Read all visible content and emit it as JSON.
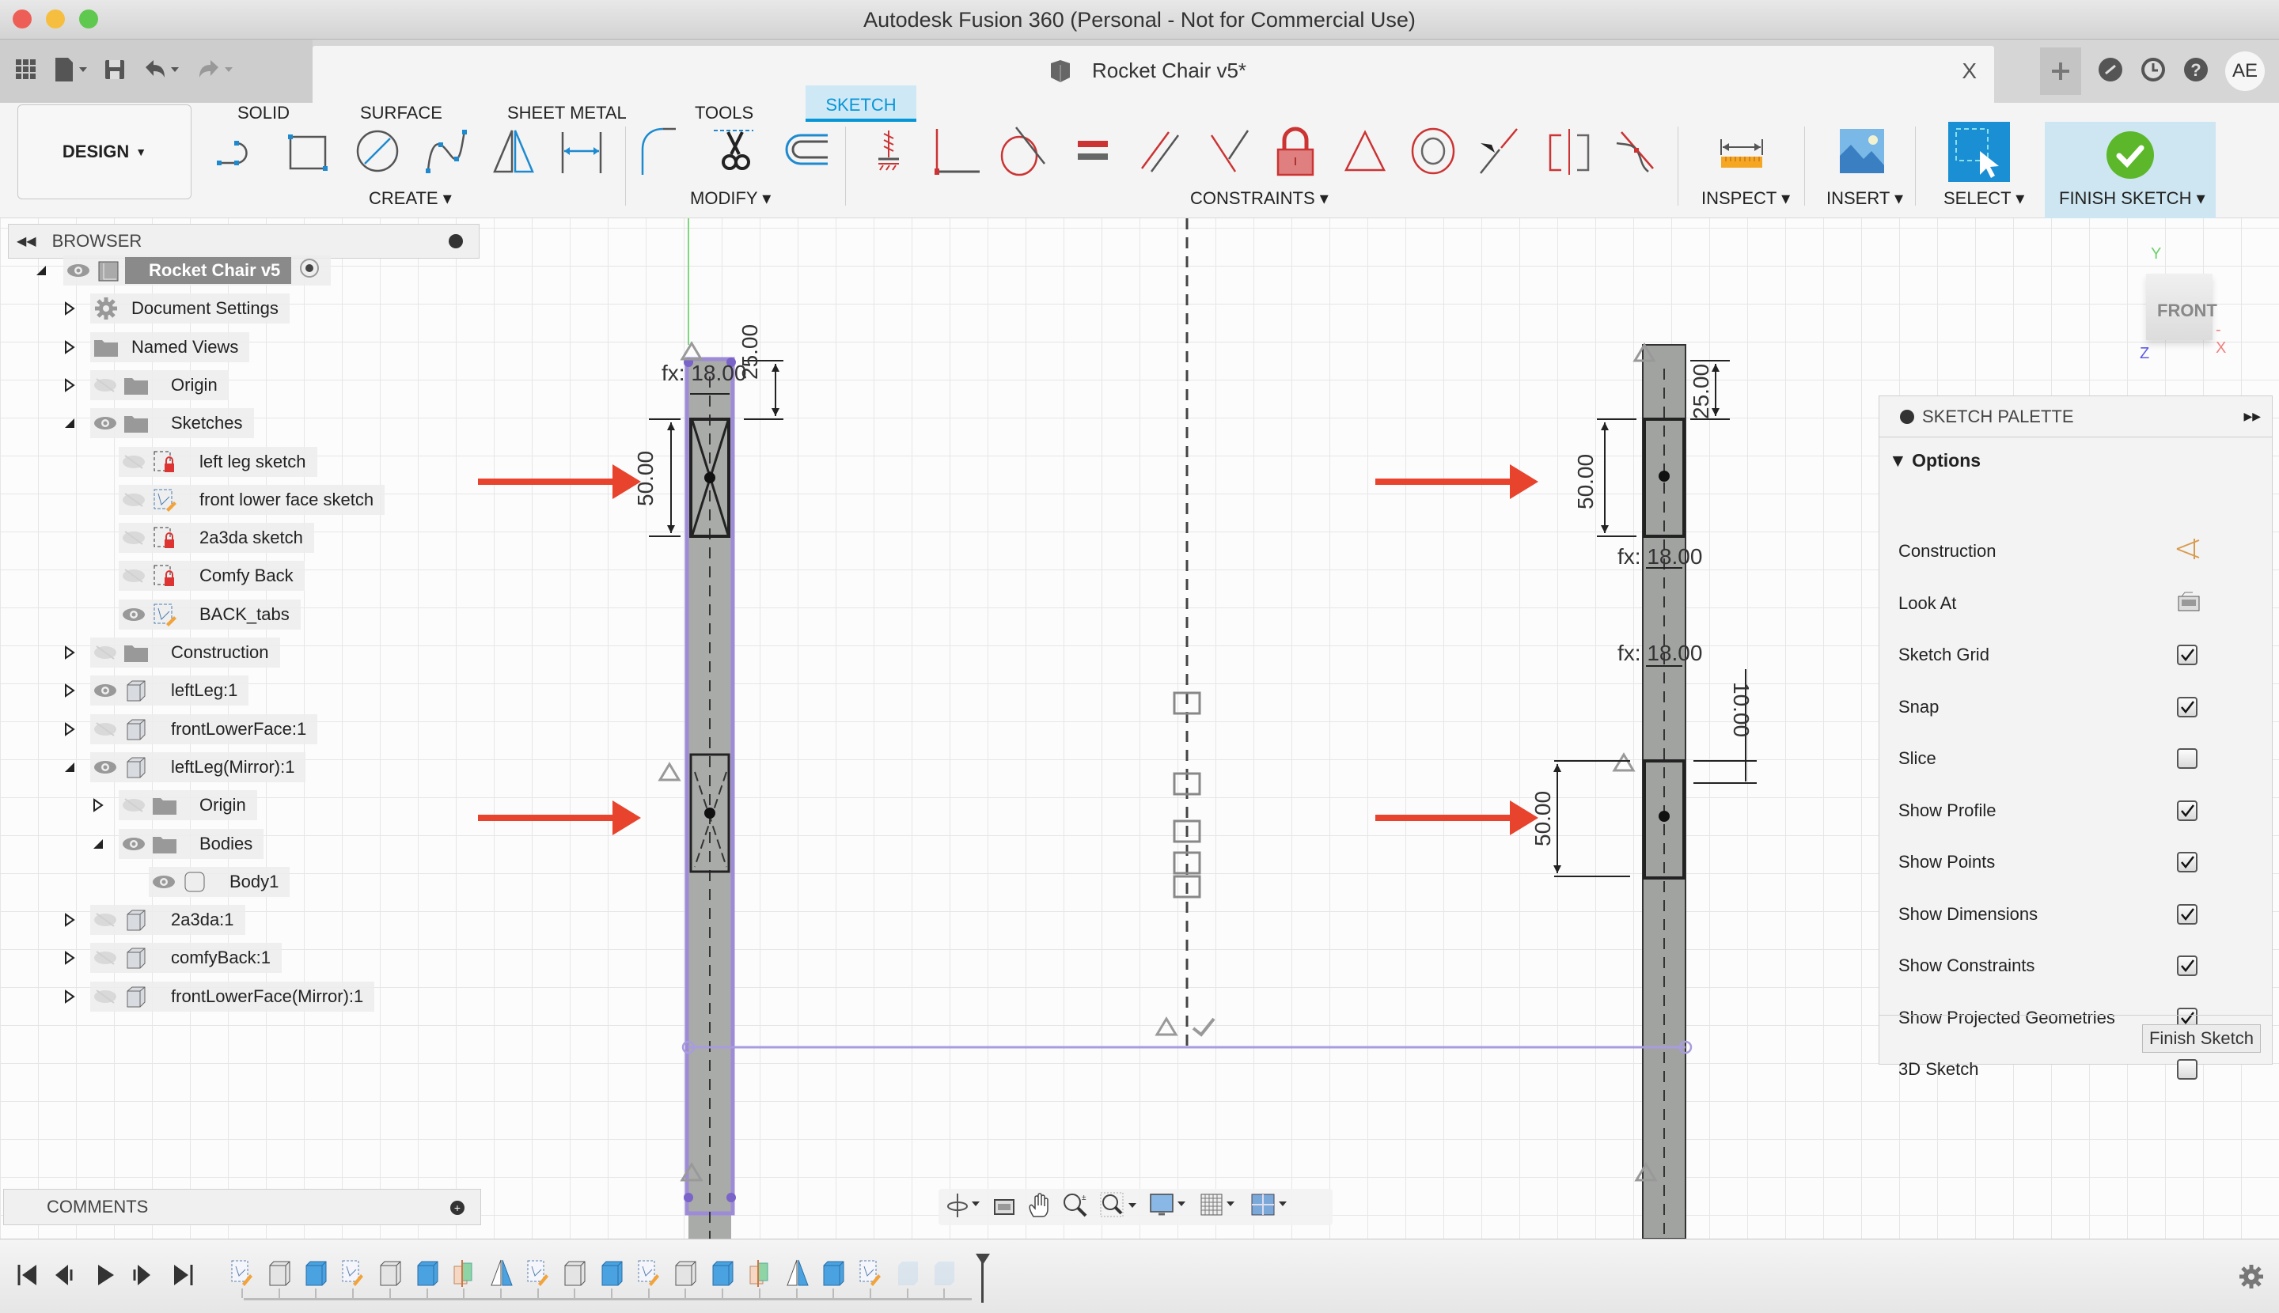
{
  "window": {
    "title": "Autodesk Fusion 360 (Personal - Not for Commercial Use)",
    "traffic_lights": {
      "close": "#ed5f56",
      "minimize": "#f6be3f",
      "zoom": "#5fc84e"
    }
  },
  "tabbar": {
    "quick_access": [
      "data-panel-icon",
      "file-menu-icon",
      "save-icon",
      "undo-icon",
      "redo-icon"
    ],
    "document_tab": "Rocket Chair v5*",
    "close_tab_glyph": "X",
    "right_icons": [
      "new-tab-icon",
      "job-status-icon",
      "history-icon",
      "help-icon"
    ],
    "user_initials": "AE"
  },
  "ribbon": {
    "workspace": "DESIGN",
    "tabs": [
      {
        "label": "SOLID",
        "active": false
      },
      {
        "label": "SURFACE",
        "active": false
      },
      {
        "label": "SHEET METAL",
        "active": false
      },
      {
        "label": "TOOLS",
        "active": false
      },
      {
        "label": "SKETCH",
        "active": true
      }
    ],
    "groups": {
      "create": {
        "label": "CREATE",
        "tools": [
          "line",
          "rectangle",
          "circle",
          "spline",
          "mirror",
          "sketch-dimension"
        ]
      },
      "modify": {
        "label": "MODIFY",
        "tools": [
          "fillet",
          "trim",
          "offset"
        ]
      },
      "constraints": {
        "label": "CONSTRAINTS",
        "tools": [
          "fix",
          "coincident",
          "tangent",
          "equal",
          "parallel",
          "perpendicular",
          "fix-unfix",
          "midpoint",
          "concentric",
          "collinear",
          "symmetry",
          "curvature"
        ]
      },
      "inspect": {
        "label": "INSPECT"
      },
      "insert": {
        "label": "INSERT"
      },
      "select": {
        "label": "SELECT"
      },
      "finish": {
        "label": "FINISH SKETCH"
      }
    },
    "accent": "#0696d7"
  },
  "browser": {
    "title": "BROWSER",
    "items": [
      {
        "label": "Rocket Chair v5",
        "depth": 0,
        "expanded": true,
        "visible": true,
        "icon": "component-icon",
        "root": true
      },
      {
        "label": "Document Settings",
        "depth": 1,
        "expanded": false,
        "icon": "gear-icon"
      },
      {
        "label": "Named Views",
        "depth": 1,
        "expanded": false,
        "icon": "folder-icon"
      },
      {
        "label": "Origin",
        "depth": 1,
        "expanded": false,
        "visible": false,
        "icon": "folder-icon"
      },
      {
        "label": "Sketches",
        "depth": 1,
        "expanded": true,
        "visible": true,
        "icon": "folder-icon"
      },
      {
        "label": "left leg sketch",
        "depth": 2,
        "visible": false,
        "icon": "locked-sketch-icon"
      },
      {
        "label": "front lower face sketch",
        "depth": 2,
        "visible": false,
        "icon": "sketch-edit-icon"
      },
      {
        "label": "2a3da sketch",
        "depth": 2,
        "visible": false,
        "icon": "locked-sketch-icon"
      },
      {
        "label": "Comfy Back",
        "depth": 2,
        "visible": false,
        "icon": "locked-sketch-icon"
      },
      {
        "label": "BACK_tabs",
        "depth": 2,
        "visible": true,
        "icon": "sketch-edit-icon"
      },
      {
        "label": "Construction",
        "depth": 1,
        "expanded": false,
        "visible": false,
        "icon": "folder-icon"
      },
      {
        "label": "leftLeg:1",
        "depth": 1,
        "expanded": false,
        "visible": true,
        "icon": "component-box-icon"
      },
      {
        "label": "frontLowerFace:1",
        "depth": 1,
        "expanded": false,
        "visible": false,
        "icon": "component-box-icon"
      },
      {
        "label": "leftLeg(Mirror):1",
        "depth": 1,
        "expanded": true,
        "visible": true,
        "icon": "component-box-icon"
      },
      {
        "label": "Origin",
        "depth": 2,
        "expanded": false,
        "visible": false,
        "icon": "folder-icon"
      },
      {
        "label": "Bodies",
        "depth": 2,
        "expanded": true,
        "visible": true,
        "icon": "folder-icon"
      },
      {
        "label": "Body1",
        "depth": 3,
        "visible": true,
        "icon": "body-icon"
      },
      {
        "label": "2a3da:1",
        "depth": 1,
        "expanded": false,
        "visible": false,
        "icon": "component-box-icon"
      },
      {
        "label": "comfyBack:1",
        "depth": 1,
        "expanded": false,
        "visible": false,
        "icon": "component-box-icon"
      },
      {
        "label": "frontLowerFace(Mirror):1",
        "depth": 1,
        "expanded": false,
        "visible": false,
        "icon": "component-box-icon"
      }
    ]
  },
  "canvas": {
    "viewcube": {
      "face": "FRONT",
      "axes": {
        "y": "Y",
        "x": "-X",
        "z": "Z"
      }
    },
    "dimensions": {
      "left_top_width": "fx: 18.00",
      "left_top_offset": "25.00",
      "left_tab_height": "50.00",
      "right_top_offset": "25.00",
      "right_tab_height_upper": "50.00",
      "right_width_1": "fx: 18.00",
      "right_width_2": "fx: 18.00",
      "right_gap": "10.00",
      "right_tab_height_lower": "50.00"
    },
    "arrow_color": "#e8432d"
  },
  "palette": {
    "title": "SKETCH PALETTE",
    "section": "Options",
    "rows": [
      {
        "label": "Construction",
        "type": "icon",
        "icon": "construction-icon"
      },
      {
        "label": "Look At",
        "type": "icon",
        "icon": "look-at-icon"
      },
      {
        "label": "Sketch Grid",
        "type": "checkbox",
        "checked": true
      },
      {
        "label": "Snap",
        "type": "checkbox",
        "checked": true
      },
      {
        "label": "Slice",
        "type": "checkbox",
        "checked": false
      },
      {
        "label": "Show Profile",
        "type": "checkbox",
        "checked": true
      },
      {
        "label": "Show Points",
        "type": "checkbox",
        "checked": true
      },
      {
        "label": "Show Dimensions",
        "type": "checkbox",
        "checked": true
      },
      {
        "label": "Show Constraints",
        "type": "checkbox",
        "checked": true
      },
      {
        "label": "Show Projected Geometries",
        "type": "checkbox",
        "checked": true
      },
      {
        "label": "3D Sketch",
        "type": "checkbox",
        "checked": false
      }
    ],
    "finish_button": "Finish Sketch"
  },
  "comments": {
    "title": "COMMENTS"
  },
  "navbar": {
    "tools": [
      "orbit-icon",
      "look-at-icon",
      "pan-icon",
      "zoom-icon",
      "fit-icon",
      "display-settings-icon",
      "grid-settings-icon",
      "viewports-icon"
    ]
  },
  "timeline": {
    "controls": [
      "first",
      "previous",
      "play",
      "next",
      "last"
    ],
    "features": [
      "sketch",
      "extrude-white",
      "extrude-blue",
      "sketch",
      "extrude-white",
      "extrude-blue",
      "mirror-plane",
      "mirror",
      "sketch",
      "extrude-white",
      "extrude-blue",
      "sketch",
      "extrude-white",
      "extrude-blue",
      "mirror-plane",
      "mirror",
      "extrude-blue",
      "sketch",
      "suppressed",
      "suppressed"
    ]
  }
}
